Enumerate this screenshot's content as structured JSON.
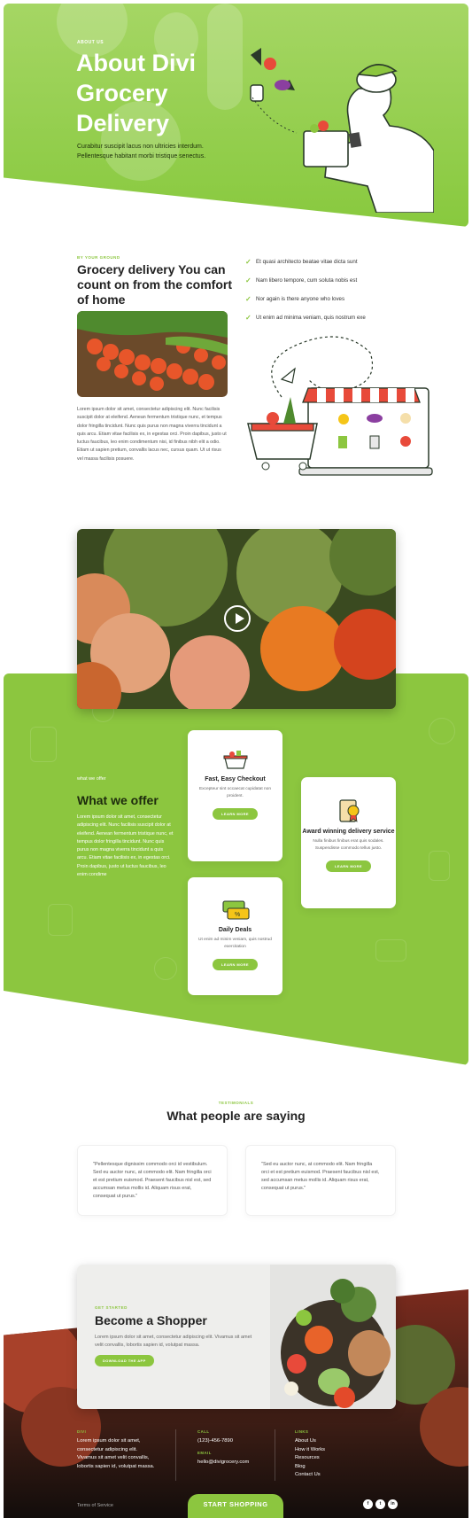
{
  "hero": {
    "kicker": "ABOUT US",
    "title": "About Divi Grocery Delivery",
    "subtitle": "Curabitur suscipit lacus non ultricies interdum. Pellentesque habitant morbi tristique senectus."
  },
  "intro": {
    "kicker": "BY YOUR GROUND",
    "title": "Grocery delivery You can count on from the comfort of home",
    "body": "Lorem ipsum dolor sit amet, consectetur adipiscing elit. Nunc facilisis suscipit dolor at eleifend. Aenean fermentum tristique nunc, et tempus dolor fringilla tincidunt. Nunc quis purus non magna viverra tincidunt a quis arcu. Etiam vitae facilisis ex, in egestas orci. Proin dapibus, justo ut luctus faucibus, leo enim condimentum nisi, id finibus nibh elit a odio. Etiam ut sapien pretium, convallis lacus nec, cursus quam. Ut ut risus vel massa facilisis posuere.",
    "checklist": [
      "Et quasi architecto beatae vitae dicta sunt",
      "Nam libero tempore, cum soluta nobis est",
      "Nor again is there anyone who loves",
      "Ut enim ad minima veniam, quis nostrum exe"
    ]
  },
  "offer": {
    "kicker": "what we offer",
    "title": "What we offer",
    "body": "Lorem ipsum dolor sit amet, consectetur adipiscing elit. Nunc facilisis suscipit dolor at eleifend. Aenean fermentum tristique nunc, et tempus dolor fringilla tincidunt. Nunc quis purus non magna viverra tincidunt a quis arcu. Etiam vitae facilisis ex, in egestas orci. Proin dapibus, justo ut luctus faucibus, leo enim condime",
    "cards": [
      {
        "title": "Fast, Easy Checkout",
        "text": "Excepteur sint occaecat cupidatat non proident.",
        "button": "LEARN MORE"
      },
      {
        "title": "Award winning delivery service",
        "text": "Nulla finibus finibus erat quis sodales. Suspendisse commodo tellus justo.",
        "button": "LEARN MORE"
      },
      {
        "title": "Daily Deals",
        "text": "Ut enim ad minim veniam, quis nostrud exercitation",
        "button": "LEARN MORE"
      }
    ]
  },
  "testimonials": {
    "kicker": "TESTIMONIALS",
    "title": "What people are saying",
    "items": [
      "\"Pellentesque dignissim commodo orci id vestibulum. Sed eu auctor nunc, at commodo elit. Nam fringilla orci et est pretium euismod. Praesent faucibus nisl est, sed accumsan metus mollis id. Aliquam risus erat, consequat ut purus.\"",
      "\"Sed eu auctor nunc, at commodo elit. Nam fringilla orci et est pretium euismod. Praesent faucibus nisl est, sed accumsan metus mollis id. Aliquam risus erat, consequat ut purus.\""
    ]
  },
  "cta": {
    "kicker": "GET STARTED",
    "title": "Become a Shopper",
    "body": "Lorem ipsum dolor sit amet, consectetur adipiscing elit. Vivamus sit amet velit convallis, lobortis sapien id, volutpat massa.",
    "button": "DOWNLOAD THE APP"
  },
  "footer": {
    "col1_head": "DIVI",
    "col1_text": "Lorem ipsum dolor sit amet, consectetur adipiscing elit. Vivamus sit amet velit convallis, lobortis sapien id, volutpat massa.",
    "col2_head": "CALL",
    "phone": "(123)-456-7890",
    "email_head": "EMAIL",
    "email": "hello@divigrocery.com",
    "col3_head": "LINKS",
    "links": [
      "About Us",
      "How it Works",
      "Resources",
      "Blog",
      "Contact Us"
    ],
    "terms": "Terms of Service",
    "start_button": "START SHOPPING",
    "social": [
      "f",
      "t",
      "in"
    ]
  },
  "colors": {
    "accent": "#8cc63f",
    "dark": "#222222"
  }
}
